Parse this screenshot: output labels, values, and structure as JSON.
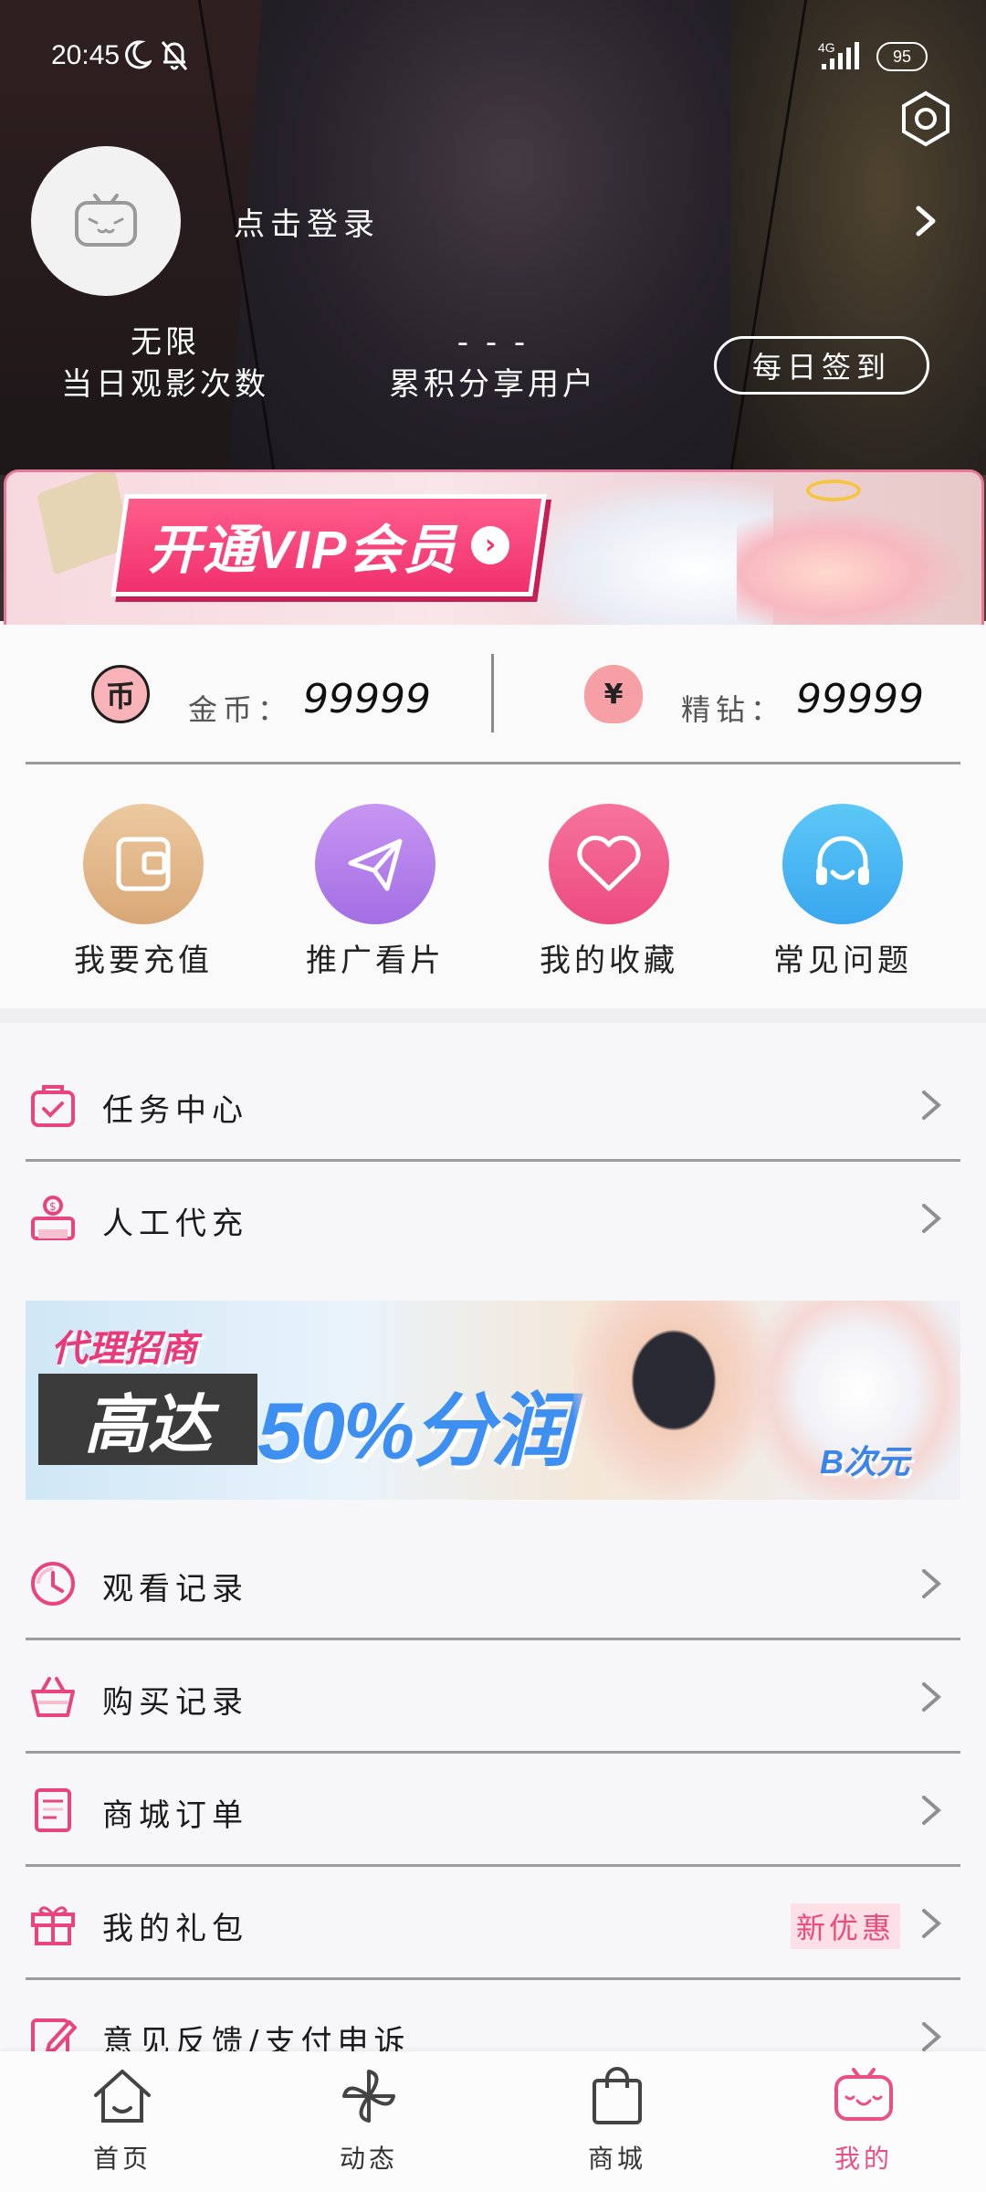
{
  "status_bar": {
    "time": "20:45",
    "network": "4G",
    "battery": "95"
  },
  "profile": {
    "login_text": "点击登录",
    "views_value": "无限",
    "views_label": "当日观影次数",
    "shares_value": "- - -",
    "shares_label": "累积分享用户",
    "checkin_button": "每日签到"
  },
  "vip_banner": {
    "label": "开通VIP会员"
  },
  "wallet": {
    "coins_label": "金币：",
    "coins_value": "99999",
    "coin_icon_text": "币",
    "diamonds_label": "精钻：",
    "diamonds_value": "99999",
    "diamond_icon_text": "¥"
  },
  "quick_actions": [
    {
      "label": "我要充值",
      "icon": "wallet-icon",
      "color": "#e3b98a"
    },
    {
      "label": "推广看片",
      "icon": "paper-plane-icon",
      "color": "#b47ee8"
    },
    {
      "label": "我的收藏",
      "icon": "heart-icon",
      "color": "#f0598d"
    },
    {
      "label": "常见问题",
      "icon": "headset-icon",
      "color": "#4bb7f2"
    }
  ],
  "menu": {
    "task_center": "任务中心",
    "manual_recharge": "人工代充",
    "watch_history": "观看记录",
    "purchase_history": "购买记录",
    "shop_orders": "商城订单",
    "my_gifts": "我的礼包",
    "my_gifts_badge": "新优惠",
    "feedback": "意见反馈/支付申诉"
  },
  "agent_banner": {
    "tag": "代理招商",
    "headline_a": "高达",
    "headline_b": "50%分润",
    "brand": "B次元"
  },
  "bottom_nav": {
    "items": [
      {
        "label": "首页",
        "icon": "home-icon"
      },
      {
        "label": "动态",
        "icon": "pinwheel-icon"
      },
      {
        "label": "商城",
        "icon": "shopping-bag-icon"
      },
      {
        "label": "我的",
        "icon": "profile-tv-icon"
      }
    ],
    "active_color": "#ea4f86"
  },
  "colors": {
    "accent": "#ea4f86",
    "menu_icon": "#e8457e"
  }
}
